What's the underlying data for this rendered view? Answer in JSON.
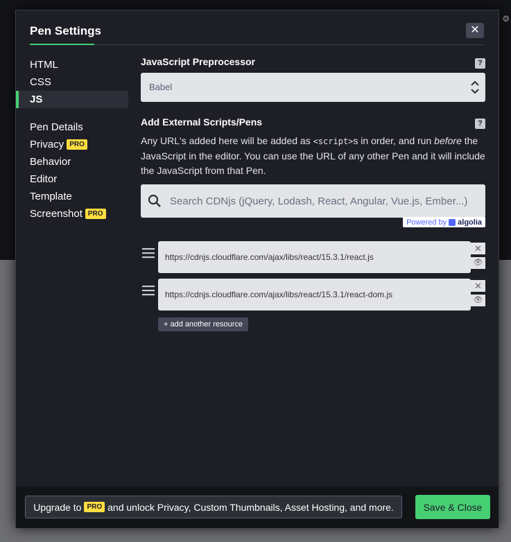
{
  "modal": {
    "title": "Pen Settings",
    "close_label": "✕"
  },
  "sidebar": {
    "items": [
      {
        "label": "HTML"
      },
      {
        "label": "CSS"
      },
      {
        "label": "JS"
      },
      {
        "label": "Pen Details"
      },
      {
        "label": "Privacy",
        "badge": "PRO"
      },
      {
        "label": "Behavior"
      },
      {
        "label": "Editor"
      },
      {
        "label": "Template"
      },
      {
        "label": "Screenshot",
        "badge": "PRO"
      }
    ],
    "active": "JS"
  },
  "preprocessor": {
    "label": "JavaScript Preprocessor",
    "help": "?",
    "selected": "Babel"
  },
  "external": {
    "label": "Add External Scripts/Pens",
    "help": "?",
    "desc_part1": "Any URL's added here will be added as ",
    "desc_code": "<script>",
    "desc_part2": "s in order, and run ",
    "desc_em": "before",
    "desc_part3": " the JavaScript in the editor. You can use the URL of any other Pen and it will include the JavaScript from that Pen.",
    "search_placeholder": "Search CDNjs (jQuery, Lodash, React, Angular, Vue.js, Ember...)",
    "powered_by": "Powered by",
    "powered_brand": "algolia",
    "resources": [
      "https://cdnjs.cloudflare.com/ajax/libs/react/15.3.1/react.js",
      "https://cdnjs.cloudflare.com/ajax/libs/react/15.3.1/react-dom.js"
    ],
    "add_label": "+ add another resource"
  },
  "footer": {
    "upgrade_prefix": "Upgrade to",
    "upgrade_badge": "PRO",
    "upgrade_suffix": "and unlock Privacy, Custom Thumbnails, Asset Hosting, and more.",
    "save_label": "Save & Close"
  },
  "colors": {
    "accent": "#47cf73",
    "pro_badge": "#ffdd40",
    "modal_bg": "#1e1f26"
  }
}
